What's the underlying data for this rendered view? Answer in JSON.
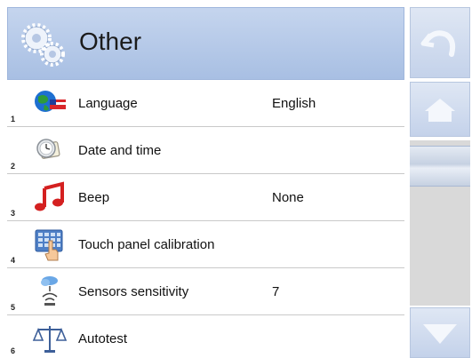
{
  "header": {
    "title": "Other",
    "icon": "gears-icon"
  },
  "menu": {
    "items": [
      {
        "number": "1",
        "label": "Language",
        "value": "English",
        "icon": "globe-flag-icon"
      },
      {
        "number": "2",
        "label": "Date and time",
        "value": "",
        "icon": "clock-icon"
      },
      {
        "number": "3",
        "label": "Beep",
        "value": "None",
        "icon": "music-note-icon"
      },
      {
        "number": "4",
        "label": "Touch panel calibration",
        "value": "",
        "icon": "touch-panel-icon"
      },
      {
        "number": "5",
        "label": "Sensors sensitivity",
        "value": "7",
        "icon": "sensor-icon"
      },
      {
        "number": "6",
        "label": "Autotest",
        "value": "",
        "icon": "balance-scale-icon"
      }
    ]
  },
  "sidebar": {
    "buttons": [
      "back-icon",
      "home-icon",
      "scroll-down-icon"
    ],
    "scroll_position": 0.05
  },
  "colors": {
    "header": "#b3c7e8",
    "button": "#cfdaee",
    "separator": "#c9c9c9"
  }
}
